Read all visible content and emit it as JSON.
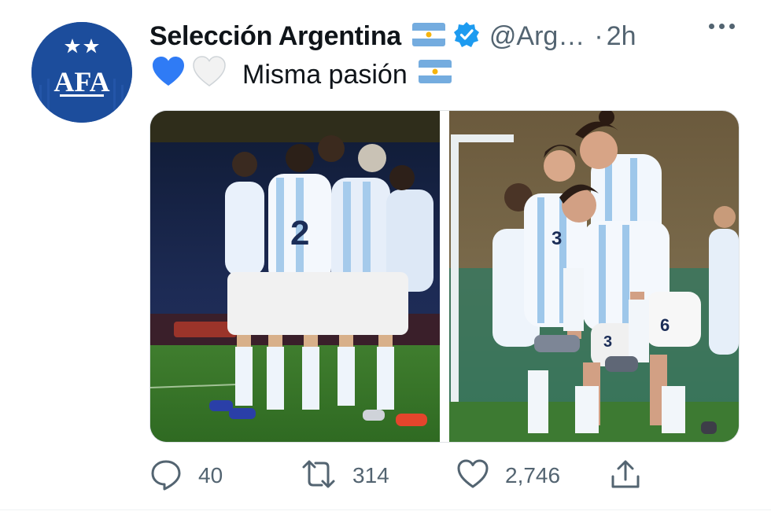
{
  "tweet": {
    "author_name": "Selección Argentina",
    "handle": "@Arg…",
    "separator": "·",
    "time": "2h",
    "text": "Misma pasión",
    "avatar_text": "AFA"
  },
  "actions": {
    "replies": "40",
    "retweets": "314",
    "likes": "2,746"
  },
  "colors": {
    "accent": "#1d9bf0",
    "secondary_text": "#536471",
    "avatar_bg": "#1c4d9c",
    "flag_blue": "#74acdf"
  }
}
